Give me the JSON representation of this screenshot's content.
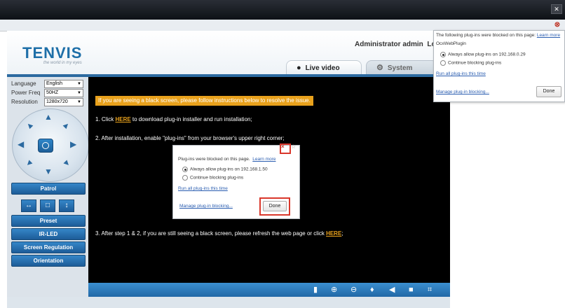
{
  "window": {
    "title": "",
    "close_glyph": "✕"
  },
  "browser": {
    "plugin_blocked_icon": "plugin-blocked-icon"
  },
  "brand": {
    "logo": "TENVIS",
    "tagline": "the world in my eyes",
    "color": "#1e6fa8"
  },
  "header": {
    "user": "Administrator admin",
    "logout": "Log"
  },
  "tabs": [
    {
      "label": "Live video",
      "icon": "camera-icon",
      "active": true
    },
    {
      "label": "System Settings",
      "icon": "gear-icon",
      "active": false
    }
  ],
  "settings": {
    "language_label": "Language",
    "language_value": "English",
    "power_label": "Power Freq",
    "power_value": "50HZ",
    "resolution_label": "Resolution",
    "resolution_value": "1280x720"
  },
  "side_buttons": {
    "patrol": "Patrol",
    "preset": "Preset",
    "irled": "IR-LED",
    "screen": "Screen Regulation",
    "orientation": "Orientation"
  },
  "video": {
    "warning": "If you are seeing a black screen, please follow instructions below to resolve the issue.",
    "step1_pre": "1. Click ",
    "step1_link": "HERE",
    "step1_post": " to download plug-in installer and run installation;",
    "step2": "2. After installation, enable \"plug-ins\" from your browser's upper right corner;",
    "step3_pre": "3. After step 1 & 2, if you are still seeing a black screen, please refresh the web page or click ",
    "step3_link": "HERE",
    "step3_post": ";"
  },
  "inner_popup": {
    "message": "Plug-ins were blocked on this page.",
    "learn_more": "Learn more",
    "option_allow": "Always allow plug-ins on 192.168.1.50",
    "option_block": "Continue blocking plug-ins",
    "run_all": "Run all plug-ins this time",
    "manage": "Manage plug-in blocking...",
    "done": "Done"
  },
  "browser_popup": {
    "message": "The following plug-ins were blocked on this page:",
    "learn_more": "Learn more",
    "plugin_name": "OcxWebPlugin",
    "option_allow": "Always allow plug-ins on 192.168.0.29",
    "option_block": "Continue blocking plug-ins",
    "run_all": "Run all plug-ins this time",
    "manage": "Manage plug-in blocking...",
    "done": "Done"
  },
  "colors": {
    "accent": "#2c6aa0",
    "warning": "#e8a11c",
    "alert": "#d9372b"
  }
}
